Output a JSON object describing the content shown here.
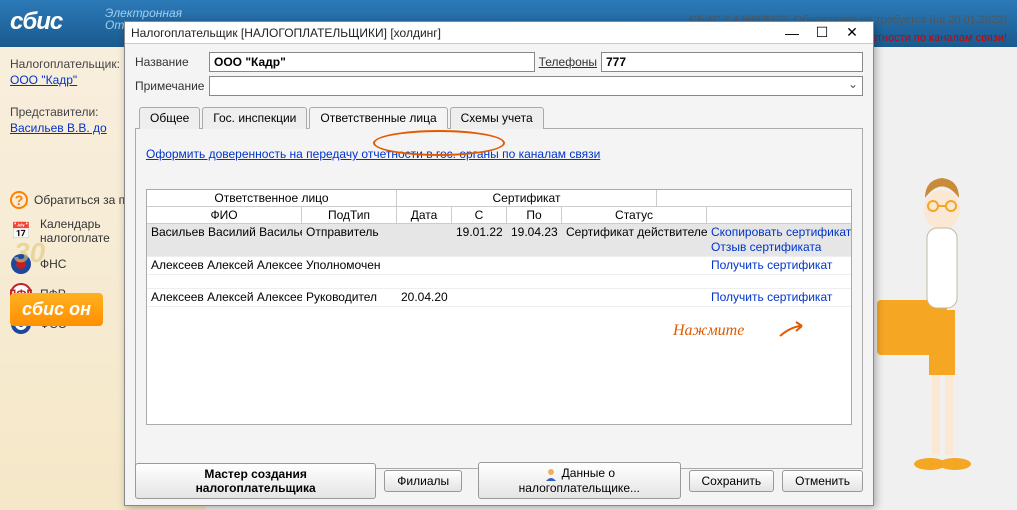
{
  "app": {
    "logo": "сбис",
    "logo_sub1": "Электронная",
    "logo_sub2": "Отче",
    "version_line": "СБИС 2.4.969/8322. Обновление не требуется (на 20.01.2022)",
    "warning": "етности по каналам связи!"
  },
  "sidebar": {
    "taxpayer_label": "Налогоплательщик:",
    "taxpayer": "ООО \"Кадр\"",
    "reps_label": "Представители:",
    "reps": "Васильев В.В. до",
    "online_btn": "сбис он",
    "big30": "30",
    "contact": "Обратиться за п",
    "items": [
      {
        "icon": "📅",
        "label": "Календарь\nналогоплате"
      },
      {
        "icon": "fns",
        "label": "ФНС"
      },
      {
        "icon": "pfr",
        "label": "ПФР"
      },
      {
        "icon": "fss",
        "label": "ФСС"
      }
    ]
  },
  "dialog": {
    "title": "Налогоплательщик [НАЛОГОПЛАТЕЛЬЩИКИ] [холдинг]",
    "fields": {
      "name_label": "Название",
      "name_value": "ООО \"Кадр\"",
      "phones_label": "Телефоны",
      "phones_value": "777",
      "note_label": "Примечание",
      "note_value": ""
    },
    "tabs": [
      "Общее",
      "Гос. инспекции",
      "Ответственные лица",
      "Схемы учета"
    ],
    "active_tab": 2,
    "link": "Оформить доверенность на передачу отчетности в гос. органы по каналам связи",
    "grid": {
      "group_person": "Ответственное лицо",
      "group_cert": "Сертификат",
      "columns": {
        "fio": "ФИО",
        "type": "ПодТип",
        "date": "Дата",
        "from": "С",
        "to": "По",
        "status": "Статус"
      },
      "rows": [
        {
          "fio": "Васильев Василий Василье",
          "type": "Отправитель",
          "date": "",
          "from": "19.01.22",
          "to": "19.04.23",
          "status": "Сертификат действителен.",
          "actions": [
            "Скопировать сертификат",
            "Отзыв сертификата"
          ],
          "selected": true
        },
        {
          "fio": "Алексеев Алексей Алексее",
          "type": "Уполномочен",
          "date": "",
          "from": "",
          "to": "",
          "status": "",
          "actions": [
            "Получить сертификат"
          ]
        },
        {
          "fio": "Алексеев Алексей Алексее",
          "type": "Руководител",
          "date": "20.04.20",
          "from": "",
          "to": "",
          "status": "",
          "actions": [
            "Получить сертификат"
          ]
        }
      ]
    },
    "annotation": "Нажмите",
    "buttons": {
      "wizard": "Мастер создания налогоплательщика",
      "branches": "Филиалы",
      "data": "Данные о налогоплательщике...",
      "save": "Сохранить",
      "cancel": "Отменить"
    }
  }
}
